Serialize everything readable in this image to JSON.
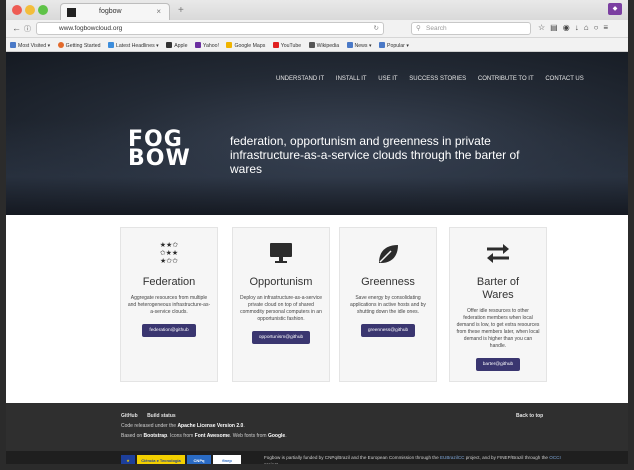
{
  "browser": {
    "tab_title": "fogbow",
    "tab_close": "×",
    "new_tab": "+",
    "url": "www.fogbowcloud.org",
    "search_placeholder": "Search",
    "bookmarks": [
      {
        "label": "Most Visited",
        "color": "#4a79c7"
      },
      {
        "label": "Getting Started",
        "color": "#e36a2b"
      },
      {
        "label": "Latest Headlines",
        "color": "#3c8ddc"
      },
      {
        "label": "Apple",
        "color": "#333333"
      },
      {
        "label": "Yahoo!",
        "color": "#6b2fa0"
      },
      {
        "label": "Google Maps",
        "color": "#f0b400"
      },
      {
        "label": "YouTube",
        "color": "#e02020"
      },
      {
        "label": "Wikipedia",
        "color": "#555555"
      },
      {
        "label": "News",
        "color": "#4a79c7"
      },
      {
        "label": "Popular",
        "color": "#4a79c7"
      }
    ]
  },
  "nav": [
    "UNDERSTAND IT",
    "INSTALL IT",
    "USE IT",
    "SUCCESS STORIES",
    "CONTRIBUTE TO IT",
    "CONTACT US"
  ],
  "hero": {
    "logo_line1": "FOG",
    "logo_line2": "BOW",
    "tagline": "federation, opportunism and greenness in private infrastructure-as-a-service clouds through the barter of wares"
  },
  "features": [
    {
      "title": "Federation",
      "icon": "stars-icon",
      "glyph": "★★✩\n✩★★\n★✩✩",
      "desc": "Aggregate resources from multiple and heterogeneous infrastructure-as-a-service clouds.",
      "button": "federation@github"
    },
    {
      "title": "Opportunism",
      "icon": "monitor-icon",
      "glyph": "",
      "desc": "Deploy an infrastructure-as-a-service private cloud on top of shared commodity personal computers in an opportunistic fashion.",
      "button": "opportunism@github"
    },
    {
      "title": "Greenness",
      "icon": "leaf-icon",
      "glyph": "",
      "desc": "Save energy by consolidating applications in active hosts and by shutting down the idle ones.",
      "button": "greenness@github"
    },
    {
      "title": "Barter of Wares",
      "icon": "exchange-icon",
      "glyph": "⇄",
      "desc": "Offer idle resources to other federation members when local demand is low, to get extra resources from these members later, when local demand is higher than you can handle.",
      "button": "barter@github"
    }
  ],
  "footer": {
    "link_github": "GitHub",
    "link_build": "Build status",
    "license_prefix": "Code released under the",
    "license": "Apache License Version 2.0",
    "based_prefix": "Based on",
    "bootstrap": "Bootstrap",
    "icons_from": "Icons from",
    "fontawesome": "Font Awesome",
    "webfonts": "Web fonts from",
    "google": "Google",
    "back_to_top": "Back to top"
  },
  "funding": {
    "text_prefix": "Fogbow is partially funded by CNPq/Brazil and the European Commission through the",
    "project1": "EUBrazilCC",
    "text_mid": "project, and by FINEP/Brazil through the",
    "project2": "OCCI",
    "text_suffix": "project.",
    "logo_mcti": "Ciência e Tecnologia",
    "logo_cnpq": "CNPq",
    "logo_finep": "finep"
  }
}
